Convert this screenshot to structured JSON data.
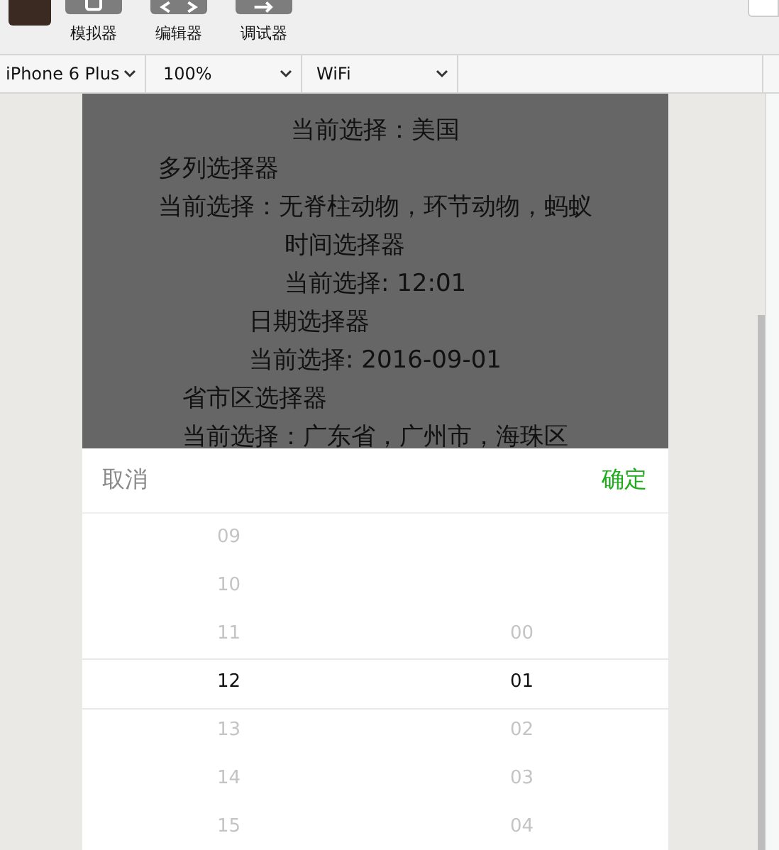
{
  "toolbar": {
    "buttons": [
      {
        "label": "模拟器",
        "kind": "phone"
      },
      {
        "label": "编辑器",
        "kind": "code"
      },
      {
        "label": "调试器",
        "kind": "debug"
      }
    ]
  },
  "device_bar": {
    "dropdowns": [
      "iPhone 6 Plus",
      "100%",
      "WiFi"
    ]
  },
  "page": {
    "sections": [
      {
        "value": "当前选择：美国"
      },
      {
        "title": "多列选择器",
        "value": "当前选择：无脊柱动物，环节动物，蚂蚁"
      },
      {
        "title": "时间选择器",
        "value": "当前选择: 12:01"
      },
      {
        "title": "日期选择器",
        "value": "当前选择: 2016-09-01"
      },
      {
        "title": "省市区选择器",
        "value": "当前选择：广东省，广州市，海珠区"
      }
    ]
  },
  "picker": {
    "cancel": "取消",
    "confirm": "确定",
    "columns": [
      {
        "items": [
          {
            "label": "09",
            "selected": false
          },
          {
            "label": "10",
            "selected": false
          },
          {
            "label": "11",
            "selected": false
          },
          {
            "label": "12",
            "selected": true
          },
          {
            "label": "13",
            "selected": false
          },
          {
            "label": "14",
            "selected": false
          },
          {
            "label": "15",
            "selected": false
          }
        ]
      },
      {
        "items": [
          {
            "label": "00",
            "selected": false
          },
          {
            "label": "01",
            "selected": true
          },
          {
            "label": "02",
            "selected": false
          },
          {
            "label": "03",
            "selected": false
          },
          {
            "label": "04",
            "selected": false
          }
        ]
      }
    ]
  }
}
